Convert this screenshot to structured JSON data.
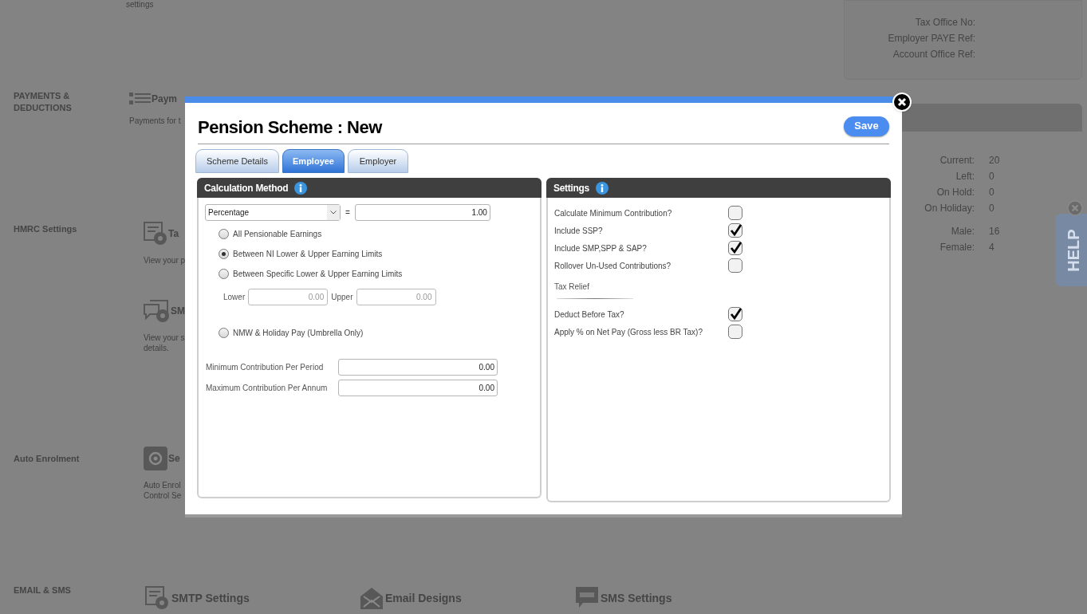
{
  "background": {
    "intro_text": "settings",
    "sections": [
      {
        "label": "PAYMENTS & DEDUCTIONS",
        "items": [
          {
            "title": "Paym",
            "description": [
              "Payments for t"
            ]
          }
        ]
      },
      {
        "label": "HMRC Settings",
        "items": [
          {
            "title": "Ta",
            "description": [
              "View your p"
            ]
          },
          {
            "title": "SM",
            "description": [
              "View your s",
              "details."
            ]
          }
        ]
      },
      {
        "label": "Auto Enrolment",
        "items": [
          {
            "title": "Se",
            "description": [
              "Auto Enrol",
              "Control Se"
            ]
          }
        ]
      },
      {
        "label": "EMAIL & SMS",
        "items": [
          {
            "title": "SMTP Settings"
          },
          {
            "title": "Email Designs"
          },
          {
            "title": "SMS Settings"
          }
        ]
      }
    ],
    "company_panel": {
      "fields": [
        "Tax Office No:",
        "Employer PAYE Ref:",
        "Account Office Ref:"
      ]
    },
    "stats_panel": {
      "groups": [
        [
          {
            "label": "Current:",
            "value": "20"
          },
          {
            "label": "Left:",
            "value": "0"
          },
          {
            "label": "On Hold:",
            "value": "0"
          },
          {
            "label": "On Holiday:",
            "value": "0"
          }
        ],
        [
          {
            "label": "Male:",
            "value": "16"
          },
          {
            "label": "Female:",
            "value": "4"
          }
        ]
      ]
    },
    "help_tab": {
      "label": "HELP"
    }
  },
  "dialog": {
    "title": "Pension Scheme : New",
    "save_button": "Save",
    "tabs": [
      {
        "label": "Scheme Details",
        "selected": false
      },
      {
        "label": "Employee",
        "selected": true
      },
      {
        "label": "Employer",
        "selected": false
      }
    ],
    "calculation_method": {
      "title": "Calculation Method",
      "method_select": "Percentage",
      "equals": "=",
      "amount": "1.00",
      "options": [
        {
          "label": "All Pensionable Earnings",
          "selected": false
        },
        {
          "label": "Between NI Lower & Upper Earning Limits",
          "selected": true
        },
        {
          "label": "Between Specific Lower & Upper Earning Limits",
          "selected": false,
          "limits": {
            "lower_label": "Lower",
            "lower_value": "0.00",
            "upper_label": "Upper",
            "upper_value": "0.00",
            "disabled": true
          }
        },
        {
          "label": "NMW & Holiday Pay (Umbrella Only)",
          "selected": false
        }
      ],
      "contributions": [
        {
          "label": "Minimum Contribution Per Period",
          "value": "0.00"
        },
        {
          "label": "Maximum Contribution Per Annum",
          "value": "0.00"
        }
      ]
    },
    "settings": {
      "title": "Settings",
      "items": [
        {
          "kind": "checkbox",
          "label": "Calculate Minimum Contribution?",
          "checked": false
        },
        {
          "kind": "checkbox",
          "label": "Include SSP?",
          "checked": true
        },
        {
          "kind": "checkbox",
          "label": "Include SMP,SPP & SAP?",
          "checked": true
        },
        {
          "kind": "checkbox",
          "label": "Rollover Un-Used Contributions?",
          "checked": false
        },
        {
          "kind": "heading",
          "label": "Tax Relief"
        },
        {
          "kind": "checkbox",
          "label": "Deduct Before Tax?",
          "checked": true
        },
        {
          "kind": "checkbox",
          "label": "Apply % on Net Pay (Gross less BR Tax)?",
          "checked": false
        }
      ]
    }
  }
}
